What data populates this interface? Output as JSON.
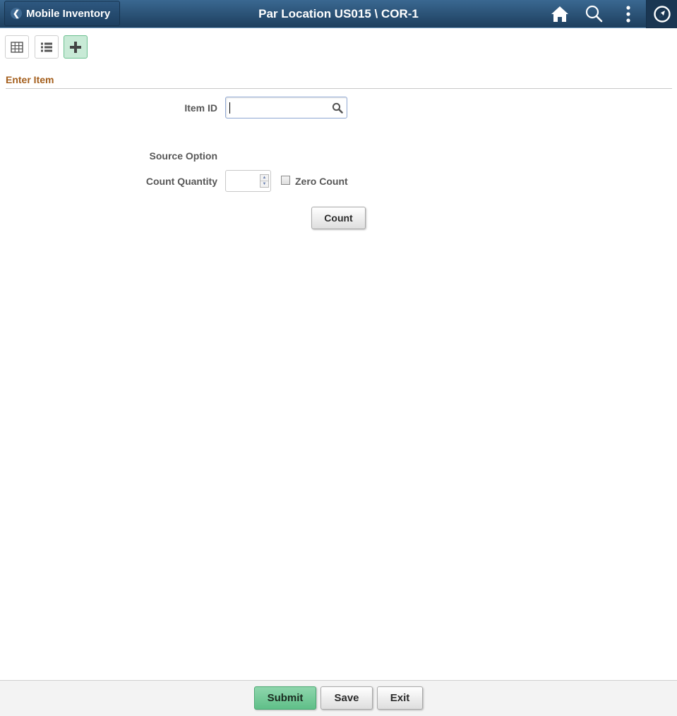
{
  "header": {
    "back_label": "Mobile Inventory",
    "title": "Par Location US015 \\ COR-1",
    "icons": [
      "home-icon",
      "search-icon",
      "actions-menu-icon",
      "navbar-compass-icon"
    ]
  },
  "toolbar": {
    "buttons": [
      {
        "name": "grid-view",
        "icon": "grid-icon",
        "active": false
      },
      {
        "name": "list-view",
        "icon": "list-icon",
        "active": false
      },
      {
        "name": "add-item",
        "icon": "plus-icon",
        "active": true
      }
    ]
  },
  "section": {
    "title": "Enter Item"
  },
  "form": {
    "item_id_label": "Item ID",
    "item_id_value": "",
    "source_option_label": "Source Option",
    "count_quantity_label": "Count Quantity",
    "count_quantity_value": "",
    "zero_count_label": "Zero Count",
    "zero_count_checked": false,
    "count_button": "Count"
  },
  "footer": {
    "submit": "Submit",
    "save": "Save",
    "exit": "Exit"
  },
  "colors": {
    "header_top": "#3a6891",
    "header_bottom": "#1d3e5d",
    "section_title": "#a45f1d",
    "primary_button": "#6cc794"
  }
}
